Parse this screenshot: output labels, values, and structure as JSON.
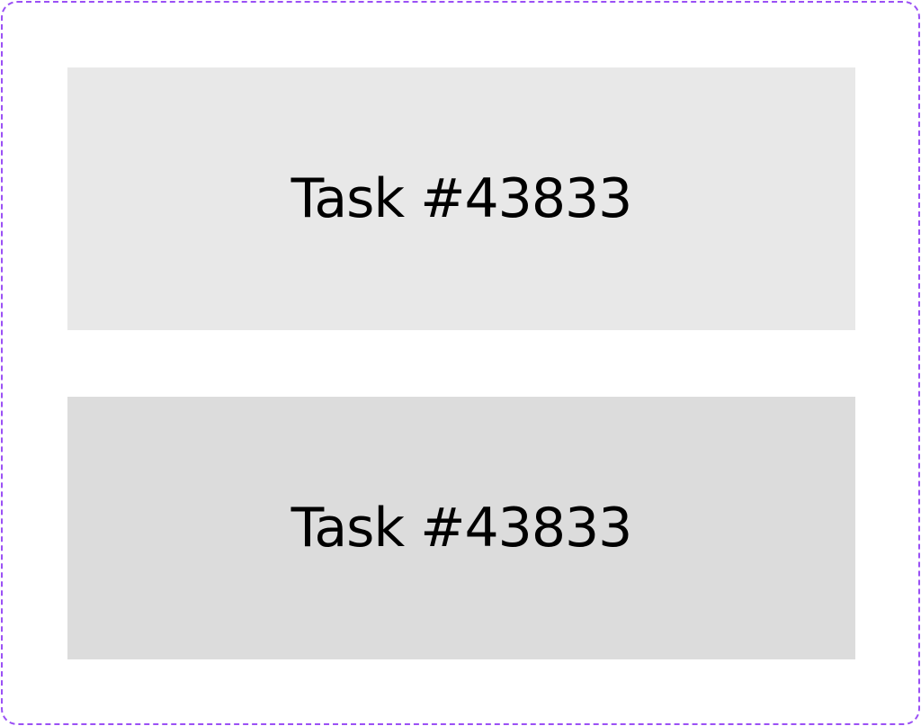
{
  "cards": [
    {
      "label": "Task #43833",
      "background": "#e8e8e8"
    },
    {
      "label": "Task #43833",
      "background": "#dcdcdc"
    }
  ],
  "frame": {
    "border_color": "#9b51f5",
    "border_style": "dashed"
  }
}
